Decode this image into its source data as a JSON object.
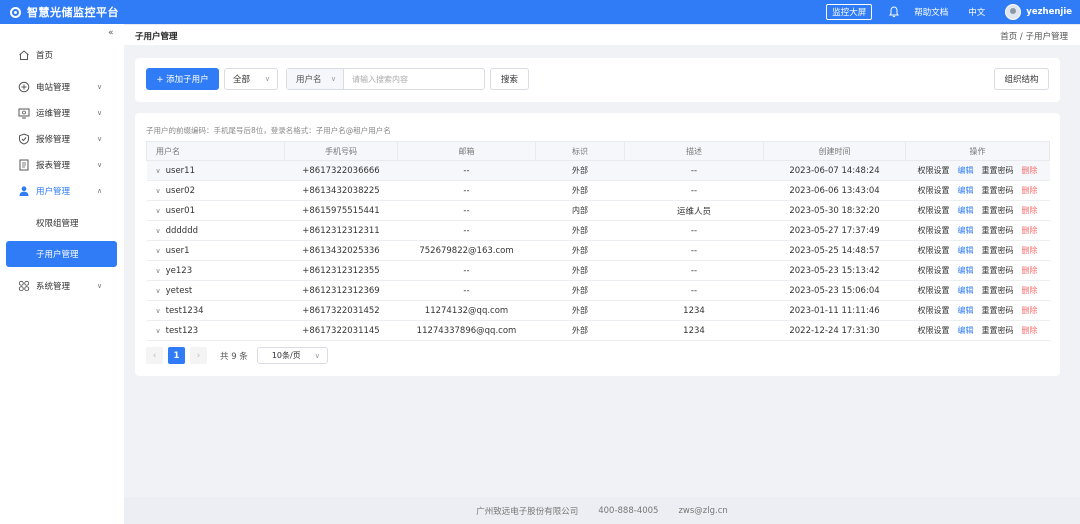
{
  "header": {
    "app_title": "智慧光储监控平台",
    "big_screen": "监控大屏",
    "help": "帮助文档",
    "language": "中文",
    "username": "yezhenjie"
  },
  "sidebar": {
    "items": [
      {
        "label": "首页",
        "icon": "home-icon"
      },
      {
        "label": "电站管理",
        "icon": "plus-circle-icon"
      },
      {
        "label": "运维管理",
        "icon": "monitor-icon"
      },
      {
        "label": "报修管理",
        "icon": "shield-icon"
      },
      {
        "label": "报表管理",
        "icon": "document-icon"
      },
      {
        "label": "用户管理",
        "icon": "user-icon"
      },
      {
        "label": "系统管理",
        "icon": "apps-icon"
      }
    ],
    "sub_items": [
      "权限组管理",
      "子用户管理"
    ]
  },
  "breadcrumb": {
    "title": "子用户管理",
    "trail": "首页 / 子用户管理"
  },
  "toolbar": {
    "add_label": "+ 添加子用户",
    "filter_value": "全部",
    "search_type": "用户名",
    "search_placeholder": "请输入搜索内容",
    "search_label": "搜索",
    "org_label": "组织结构"
  },
  "table": {
    "hint": "子用户的前缀编码：手机尾号后8位，登录名格式：子用户名@租户用户名",
    "columns": [
      "用户名",
      "手机号码",
      "邮箱",
      "标识",
      "描述",
      "创建时间",
      "操作"
    ],
    "rows": [
      {
        "username": "user11",
        "phone": "+8617322036666",
        "email": "--",
        "tag": "外部",
        "desc": "--",
        "created": "2023-06-07 14:48:24"
      },
      {
        "username": "user02",
        "phone": "+8613432038225",
        "email": "--",
        "tag": "外部",
        "desc": "--",
        "created": "2023-06-06 13:43:04"
      },
      {
        "username": "user01",
        "phone": "+8615975515441",
        "email": "--",
        "tag": "内部",
        "desc": "运维人员",
        "created": "2023-05-30 18:32:20"
      },
      {
        "username": "dddddd",
        "phone": "+8612312312311",
        "email": "--",
        "tag": "外部",
        "desc": "--",
        "created": "2023-05-27 17:37:49"
      },
      {
        "username": "user1",
        "phone": "+8613432025336",
        "email": "752679822@163.com",
        "tag": "外部",
        "desc": "--",
        "created": "2023-05-25 14:48:57"
      },
      {
        "username": "ye123",
        "phone": "+8612312312355",
        "email": "--",
        "tag": "外部",
        "desc": "--",
        "created": "2023-05-23 15:13:42"
      },
      {
        "username": "yetest",
        "phone": "+8612312312369",
        "email": "--",
        "tag": "外部",
        "desc": "--",
        "created": "2023-05-23 15:06:04"
      },
      {
        "username": "test1234",
        "phone": "+8617322031452",
        "email": "11274132@qq.com",
        "tag": "外部",
        "desc": "1234",
        "created": "2023-01-11 11:11:46"
      },
      {
        "username": "test123",
        "phone": "+8617322031145",
        "email": "11274337896@qq.com",
        "tag": "外部",
        "desc": "1234",
        "created": "2022-12-24 17:31:30"
      }
    ],
    "actions": {
      "perm": "权限设置",
      "edit": "编辑",
      "reset": "重置密码",
      "delete": "删除"
    }
  },
  "pagination": {
    "current": "1",
    "total": "共 9 条",
    "page_size": "10条/页"
  },
  "footer": {
    "company": "广州致远电子股份有限公司",
    "phone": "400-888-4005",
    "email": "zws@zlg.cn"
  }
}
